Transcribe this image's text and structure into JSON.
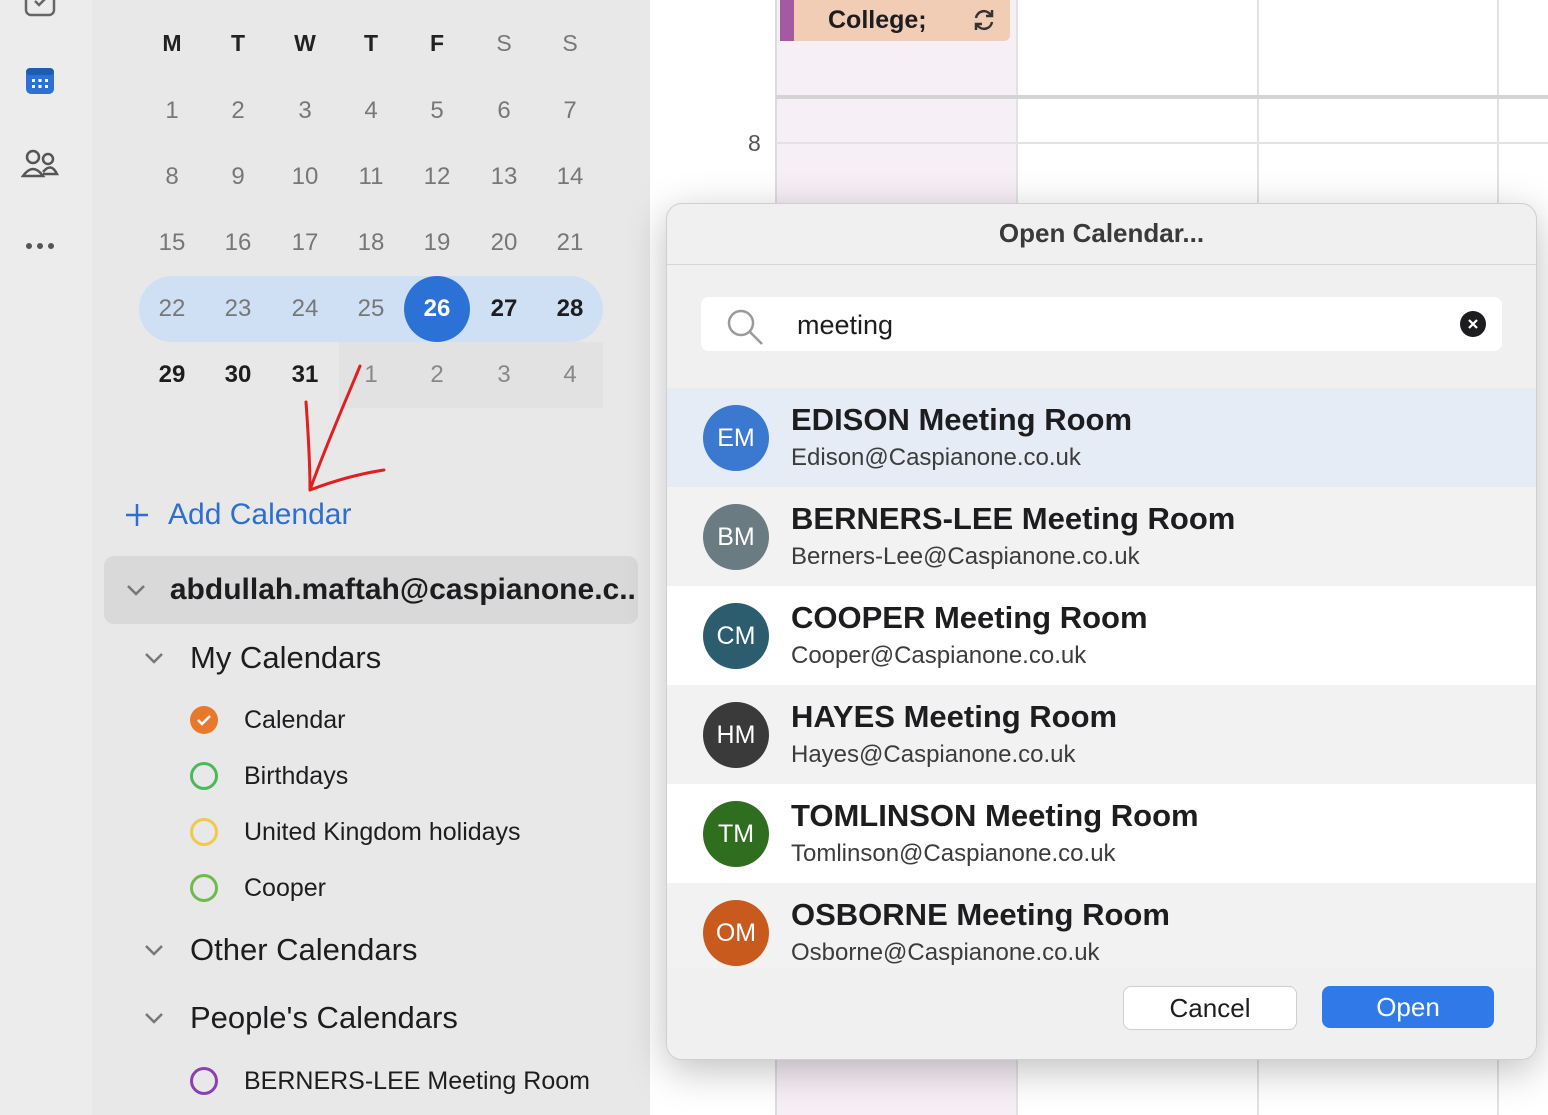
{
  "mini_calendar": {
    "weekdays": [
      "M",
      "T",
      "W",
      "T",
      "F",
      "S",
      "S"
    ],
    "weeks": [
      [
        "1",
        "2",
        "3",
        "4",
        "5",
        "6",
        "7"
      ],
      [
        "8",
        "9",
        "10",
        "11",
        "12",
        "13",
        "14"
      ],
      [
        "15",
        "16",
        "17",
        "18",
        "19",
        "20",
        "21"
      ],
      [
        "22",
        "23",
        "24",
        "25",
        "26",
        "27",
        "28"
      ],
      [
        "29",
        "30",
        "31",
        "1",
        "2",
        "3",
        "4"
      ]
    ],
    "today": "26",
    "accent": "#2c72d6"
  },
  "sidebar": {
    "add_calendar": "Add Calendar",
    "account": "abdullah.maftah@caspianone.c..",
    "my_calendars": "My Calendars",
    "calendars": [
      {
        "label": "Calendar",
        "color": "#e8782b",
        "checked": true
      },
      {
        "label": "Birthdays",
        "color": "#4bb85a",
        "checked": false
      },
      {
        "label": "United Kingdom holidays",
        "color": "#f0c94a",
        "checked": false
      },
      {
        "label": "Cooper",
        "color": "#6dbb4e",
        "checked": false
      }
    ],
    "other_calendars": "Other Calendars",
    "peoples_calendars": "People's Calendars",
    "people": [
      {
        "label": "BERNERS-LEE Meeting Room",
        "color": "#8a3fb5"
      }
    ]
  },
  "grid": {
    "hour_label": "8",
    "event_title": "College;"
  },
  "dialog": {
    "title": "Open Calendar...",
    "search_value": "meeting",
    "results": [
      {
        "initials": "EM",
        "name": "EDISON Meeting Room",
        "email": "Edison@Caspianone.co.uk",
        "color": "#3b78d0"
      },
      {
        "initials": "BM",
        "name": "BERNERS-LEE Meeting Room",
        "email": "Berners-Lee@Caspianone.co.uk",
        "color": "#6b7b82"
      },
      {
        "initials": "CM",
        "name": "COOPER Meeting Room",
        "email": "Cooper@Caspianone.co.uk",
        "color": "#2b5d6e"
      },
      {
        "initials": "HM",
        "name": "HAYES Meeting Room",
        "email": "Hayes@Caspianone.co.uk",
        "color": "#3a3a3a"
      },
      {
        "initials": "TM",
        "name": "TOMLINSON Meeting Room",
        "email": "Tomlinson@Caspianone.co.uk",
        "color": "#2f6e1f"
      },
      {
        "initials": "OM",
        "name": "OSBORNE Meeting Room",
        "email": "Osborne@Caspianone.co.uk",
        "color": "#c85a1e"
      }
    ],
    "cancel": "Cancel",
    "open": "Open"
  }
}
